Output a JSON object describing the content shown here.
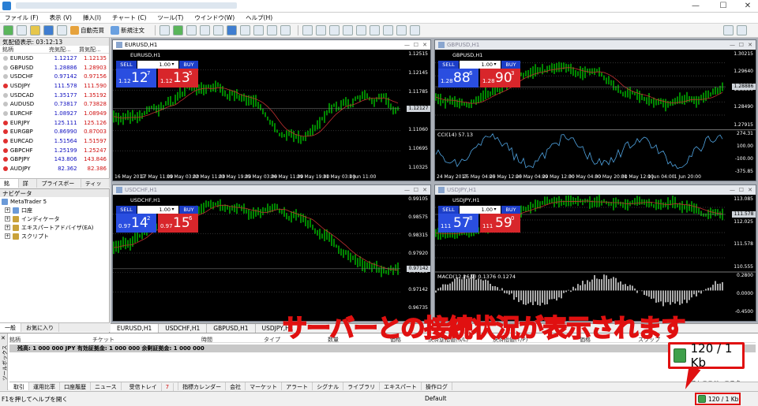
{
  "window": {
    "minimize": "—",
    "maximize": "☐",
    "close": "✕"
  },
  "menu": [
    "ファイル (F)",
    "表示 (V)",
    "挿入(I)",
    "チャート (C)",
    "ツール(T)",
    "ウインドウ(W)",
    "ヘルプ(H)"
  ],
  "toolbar": {
    "auto_trade": "自動売買",
    "new_order": "新規注文"
  },
  "market_watch": {
    "title": "気配値表示: 03:12:13",
    "columns": [
      "銘柄",
      "売気配...",
      "買気配..."
    ],
    "rows": [
      {
        "symbol": "EURUSD",
        "bid": "1.12127",
        "ask": "1.12135",
        "dir": "down"
      },
      {
        "symbol": "GBPUSD",
        "bid": "1.28886",
        "ask": "1.28903",
        "dir": "down"
      },
      {
        "symbol": "USDCHF",
        "bid": "0.97142",
        "ask": "0.97156",
        "dir": "down"
      },
      {
        "symbol": "USDJPY",
        "bid": "111.578",
        "ask": "111.590",
        "dir": "up"
      },
      {
        "symbol": "USDCAD",
        "bid": "1.35177",
        "ask": "1.35192",
        "dir": "down"
      },
      {
        "symbol": "AUDUSD",
        "bid": "0.73817",
        "ask": "0.73828",
        "dir": "down"
      },
      {
        "symbol": "EURCHF",
        "bid": "1.08927",
        "ask": "1.08949",
        "dir": "down"
      },
      {
        "symbol": "EURJPY",
        "bid": "125.111",
        "ask": "125.126",
        "dir": "up"
      },
      {
        "symbol": "EURGBP",
        "bid": "0.86990",
        "ask": "0.87003",
        "dir": "up"
      },
      {
        "symbol": "EURCAD",
        "bid": "1.51564",
        "ask": "1.51597",
        "dir": "up"
      },
      {
        "symbol": "GBPCHF",
        "bid": "1.25199",
        "ask": "1.25247",
        "dir": "up"
      },
      {
        "symbol": "GBPJPY",
        "bid": "143.806",
        "ask": "143.846",
        "dir": "up"
      },
      {
        "symbol": "AUDJPY",
        "bid": "82.362",
        "ask": "82.386",
        "dir": "up"
      }
    ],
    "tabs": [
      "銘柄",
      "詳細",
      "プライスボード",
      "ティック"
    ]
  },
  "navigator": {
    "title": "ナビゲータ",
    "root": "MetaTrader 5",
    "items": [
      "口座",
      "インディケータ",
      "エキスパートアドバイザ(EA)",
      "スクリプト"
    ],
    "tabs": [
      "一般",
      "お気に入り"
    ]
  },
  "charts": [
    {
      "caption": "EURUSD,H1",
      "symbol": "EURUSD,H1",
      "sell": "SELL",
      "buy": "BUY",
      "lot": "1.00",
      "sell_price": {
        "p1": "1.12",
        "p2": "12",
        "p3": "7"
      },
      "buy_price": {
        "p1": "1.12",
        "p2": "13",
        "p3": "5"
      },
      "yticks": [
        "1.12515",
        "1.12145",
        "1.11785",
        "1.11450",
        "1.11060",
        "1.10695",
        "1.10325"
      ],
      "tag": "1.12127",
      "xticks": [
        "16 May 2017",
        "17 May 11:00",
        "19 May 03:00",
        "22 May 11:00",
        "23 May 19:00",
        "25 May 03:00",
        "26 May 11:00",
        "29 May 19:00",
        "31 May 03:00",
        "1 Jun 11:00"
      ]
    },
    {
      "caption": "GBPUSD,H1",
      "symbol": "GBPUSD,H1",
      "sell": "SELL",
      "buy": "BUY",
      "lot": "1.00",
      "sell_price": {
        "p1": "1.28",
        "p2": "88",
        "p3": "6"
      },
      "buy_price": {
        "p1": "1.28",
        "p2": "90",
        "p3": "3"
      },
      "yticks": [
        "1.30215",
        "1.29640",
        "1.28886",
        "1.28490",
        "1.27915"
      ],
      "tag": "1.28886",
      "ind": "CCI(14) 57.13",
      "ind_ticks": [
        "274.31",
        "100.00",
        "-100.00",
        "-375.85"
      ],
      "xticks": [
        "24 May 2017",
        "25 May 04:00",
        "25 May 12:00",
        "26 May 04:00",
        "29 May 12:00",
        "30 May 04:00",
        "30 May 20:00",
        "31 May 12:00",
        "1 Jun 04:00",
        "1 Jun 20:00"
      ]
    },
    {
      "caption": "USDCHF,H1",
      "symbol": "USDCHF,H1",
      "sell": "SELL",
      "buy": "BUY",
      "lot": "1.00",
      "sell_price": {
        "p1": "0.97",
        "p2": "14",
        "p3": "2"
      },
      "buy_price": {
        "p1": "0.97",
        "p2": "15",
        "p3": "6"
      },
      "yticks": [
        "0.99105",
        "0.98575",
        "0.98315",
        "0.97920",
        "0.97525",
        "0.97142",
        "0.96735"
      ],
      "tag": "0.97142",
      "xticks": []
    },
    {
      "caption": "USDJPY,H1",
      "symbol": "USDJPY,H1",
      "sell": "SELL",
      "buy": "BUY",
      "lot": "1.00",
      "sell_price": {
        "p1": "111",
        "p2": "57",
        "p3": "8"
      },
      "buy_price": {
        "p1": "111",
        "p2": "59",
        "p3": "0"
      },
      "yticks": [
        "113.085",
        "112.025",
        "111.578",
        "110.555"
      ],
      "tag": "111.578",
      "ind": "MACD(12,26,9) 0.1376 0.1274",
      "ind_ticks": [
        "0.2800",
        "0.0000",
        "-0.4500"
      ],
      "xticks": []
    }
  ],
  "chart_tabs": [
    "EURUSD,H1",
    "USDCHF,H1",
    "GBPUSD,H1",
    "USDJPY,H1"
  ],
  "toolbox": {
    "side_label": "ツールボックス",
    "columns": [
      "銘柄",
      "チケット",
      "時間",
      "タイプ",
      "数量",
      "価格",
      "決済逆指値(S/L)",
      "決済指値(T/P)",
      "価格",
      "スワップ"
    ],
    "balance": "残高: 1 000 000 JPY  有効証拠金: 1 000 000  余剰証拠金: 1 000 000",
    "tabs": [
      "取引",
      "運用比率",
      "口座履歴",
      "ニュース",
      "受信トレイ",
      "指標カレンダー",
      "会社",
      "マーケット",
      "アラート",
      "シグナル",
      "ライブラリ",
      "エキスパート",
      "操作ログ"
    ],
    "inbox_badge": "7",
    "right_hint": "ストラテジーテスター"
  },
  "status": {
    "help": "F1を押してヘルプを開く",
    "profile": "Default",
    "connection": "120 / 1 Kb"
  },
  "annotation": {
    "text": "サーバーとの接続状況が表示されます",
    "callout": "120 / 1 Kb"
  },
  "colors": {
    "candle": "#00c000",
    "ma": "#c03030",
    "sell": "#2a4ee0",
    "buy": "#d8262b",
    "annot": "#e01010"
  }
}
